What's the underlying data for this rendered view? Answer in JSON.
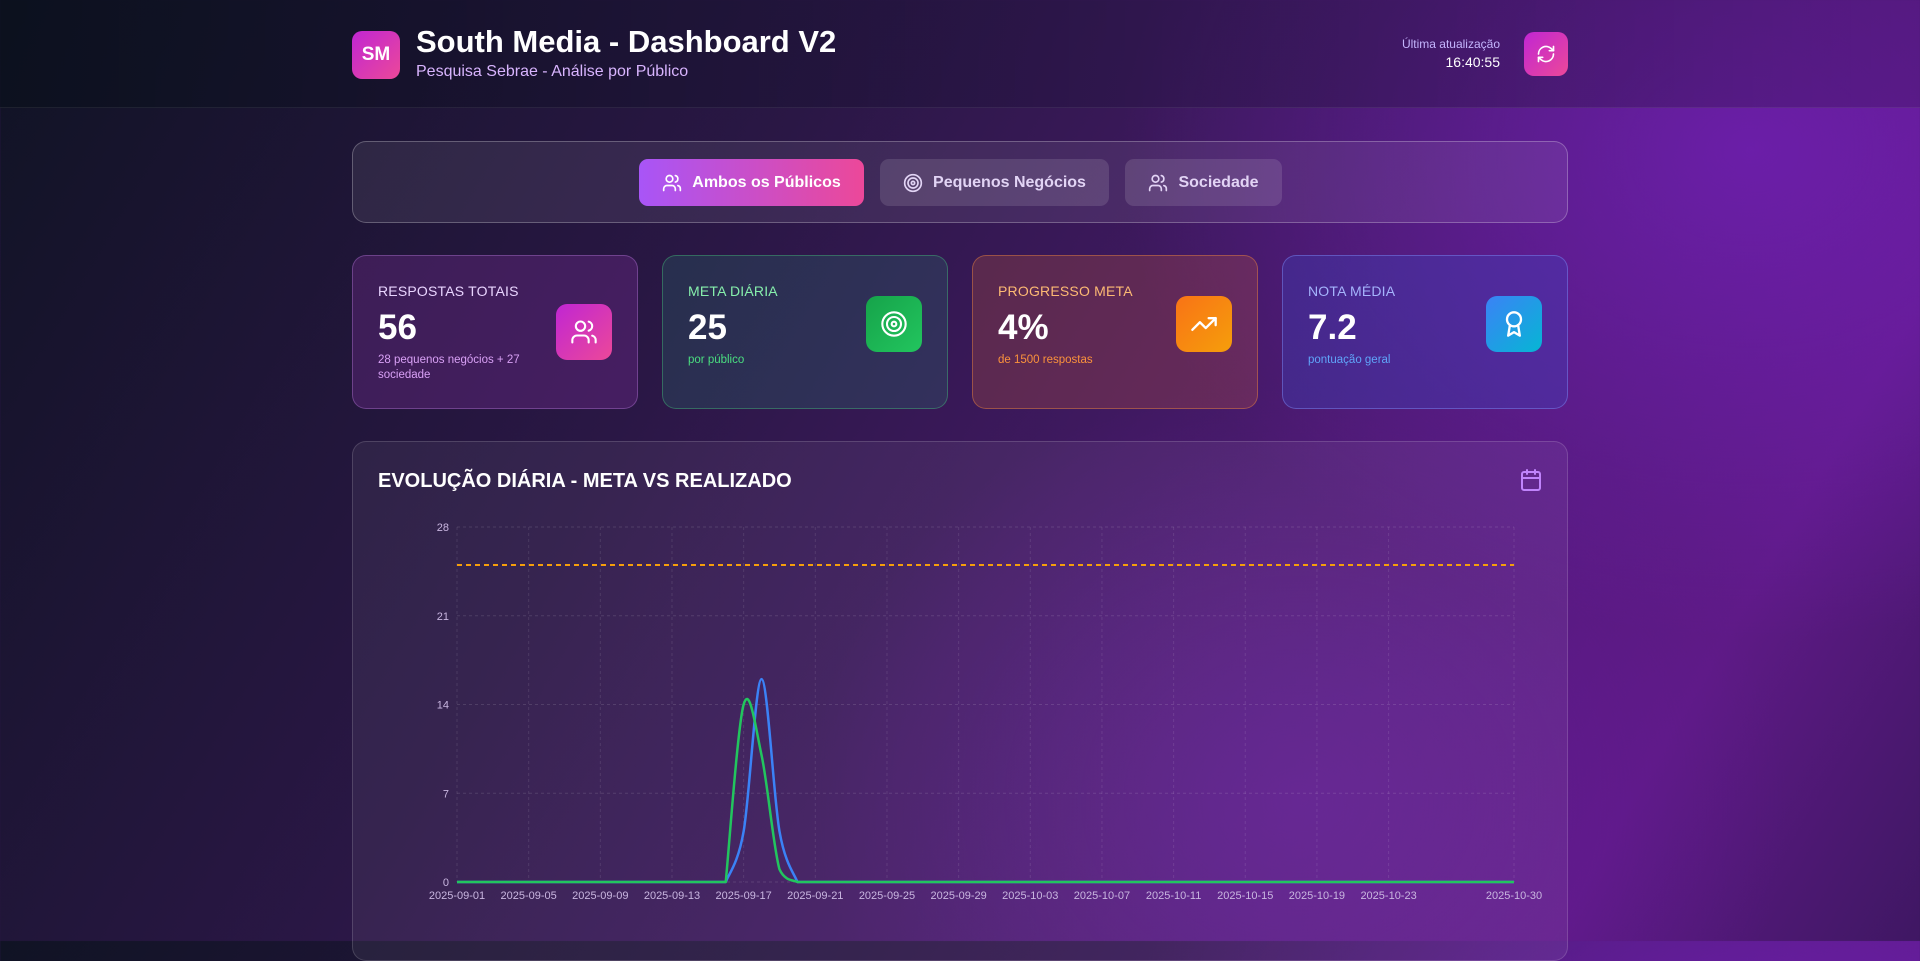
{
  "header": {
    "logo_text": "SM",
    "title": "South Media - Dashboard V2",
    "subtitle": "Pesquisa Sebrae - Análise por Público",
    "update_label": "Última atualização",
    "update_time": "16:40:55"
  },
  "filters": [
    {
      "label": "Ambos os Públicos",
      "icon": "users-icon",
      "active": true
    },
    {
      "label": "Pequenos Negócios",
      "icon": "target-icon",
      "active": false
    },
    {
      "label": "Sociedade",
      "icon": "users-icon",
      "active": false
    }
  ],
  "cards": [
    {
      "label": "RESPOSTAS TOTAIS",
      "value": "56",
      "sub": "28 pequenos negócios + 27 sociedade",
      "icon": "users-icon"
    },
    {
      "label": "META DIÁRIA",
      "value": "25",
      "sub": "por público",
      "icon": "target-icon"
    },
    {
      "label": "PROGRESSO META",
      "value": "4%",
      "sub": "de 1500 respostas",
      "icon": "trending-up-icon"
    },
    {
      "label": "NOTA MÉDIA",
      "value": "7.2",
      "sub": "pontuação geral",
      "icon": "award-icon"
    }
  ],
  "chart": {
    "title": "EVOLUÇÃO DIÁRIA - META VS REALIZADO",
    "icon": "calendar-icon"
  },
  "chart_data": {
    "type": "line",
    "x_start": "2025-09-01",
    "x_end": "2025-10-30",
    "x_tick_labels": [
      "2025-09-01",
      "2025-09-05",
      "2025-09-09",
      "2025-09-13",
      "2025-09-17",
      "2025-09-21",
      "2025-09-25",
      "2025-09-29",
      "2025-10-03",
      "2025-10-07",
      "2025-10-11",
      "2025-10-15",
      "2025-10-19",
      "2025-10-23",
      "2025-10-30"
    ],
    "y_ticks": [
      0,
      7,
      14,
      21,
      28
    ],
    "ylim": [
      0,
      28
    ],
    "grid": true,
    "meta_line": {
      "value": 25,
      "color": "#f59e0b",
      "style": "dashed"
    },
    "series": [
      {
        "color": "#3b82f6",
        "points": [
          [
            "2025-09-16",
            0
          ],
          [
            "2025-09-17",
            4
          ],
          [
            "2025-09-18",
            16
          ],
          [
            "2025-09-19",
            4
          ],
          [
            "2025-09-20",
            0
          ]
        ]
      },
      {
        "color": "#22c55e",
        "points": [
          [
            "2025-09-16",
            0
          ],
          [
            "2025-09-17",
            14
          ],
          [
            "2025-09-18",
            10
          ],
          [
            "2025-09-19",
            1
          ],
          [
            "2025-09-20",
            0
          ]
        ]
      }
    ]
  }
}
